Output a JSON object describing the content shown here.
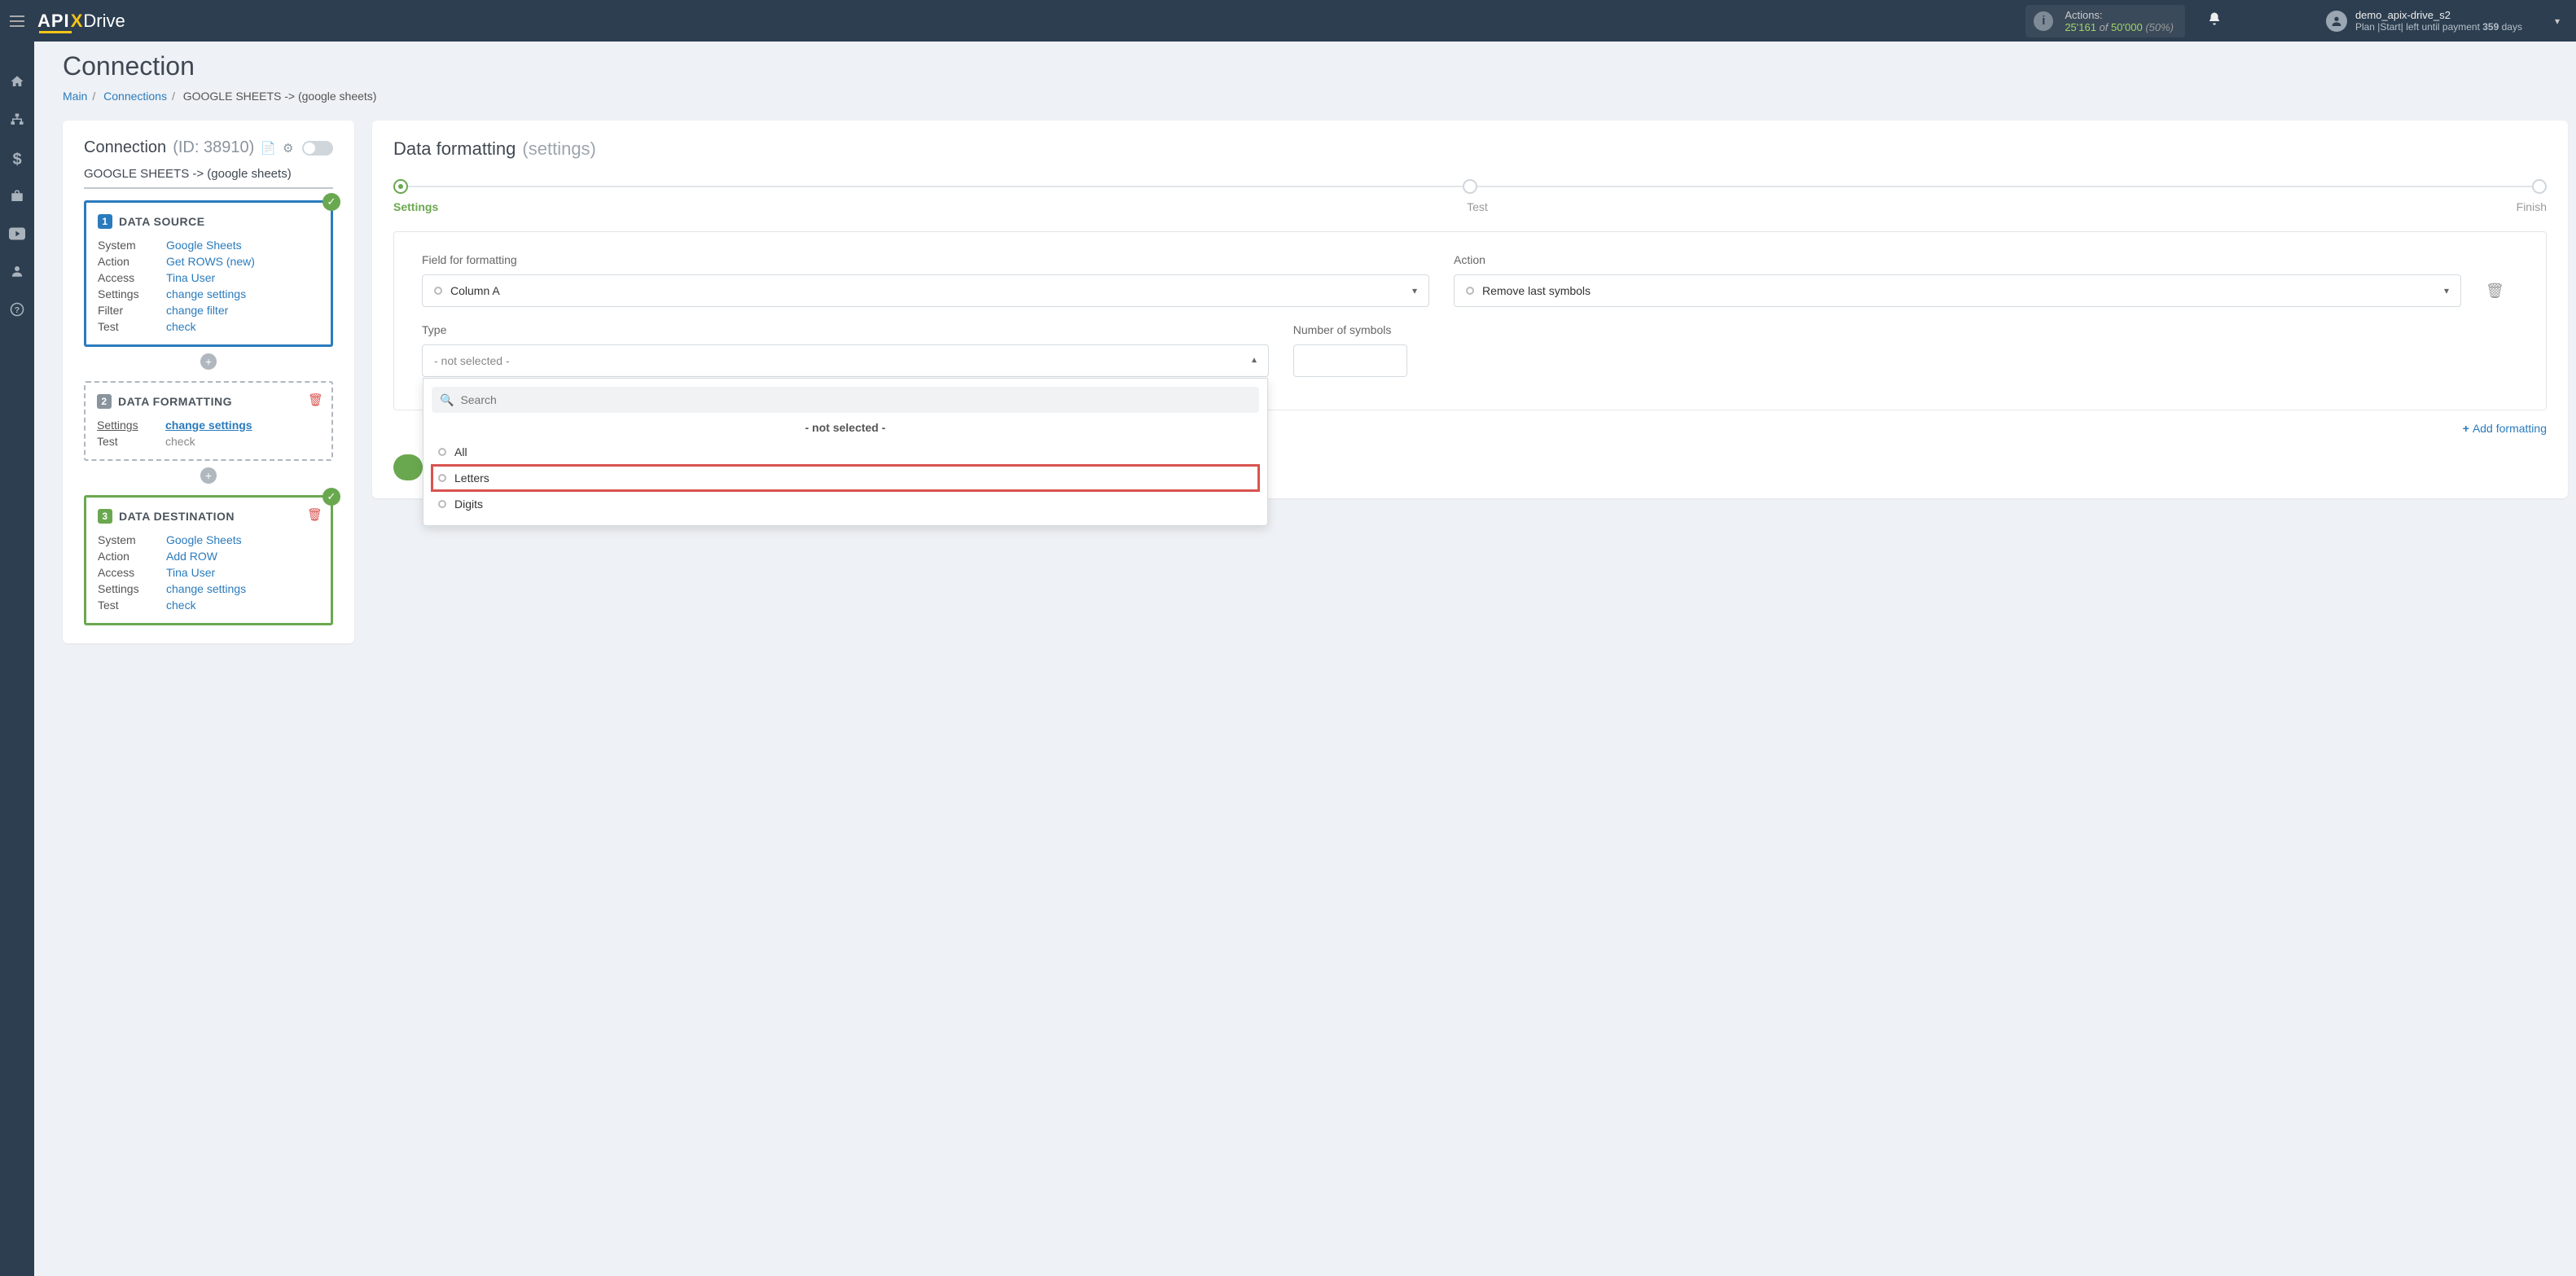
{
  "header": {
    "logo_parts": {
      "api": "API",
      "x": "X",
      "drive": "Drive"
    },
    "actions": {
      "label": "Actions:",
      "used": "25'161",
      "of": "of",
      "total": "50'000",
      "pct": "(50%)"
    },
    "user": {
      "name": "demo_apix-drive_s2",
      "plan_prefix": "Plan |Start| left until payment ",
      "days": "359",
      "plan_suffix": " days"
    }
  },
  "sidebar_icons": [
    "home",
    "sitemap",
    "dollar",
    "briefcase",
    "youtube",
    "user",
    "question"
  ],
  "page": {
    "title": "Connection",
    "breadcrumb": {
      "main": "Main",
      "connections": "Connections",
      "current": "GOOGLE SHEETS -> (google sheets)"
    }
  },
  "conn": {
    "title": "Connection",
    "id_label": "(ID: 38910)",
    "sub": "GOOGLE SHEETS -> (google sheets)"
  },
  "blocks": {
    "source": {
      "num": "1",
      "title": "DATA SOURCE",
      "rows": [
        {
          "k": "System",
          "v": "Google Sheets"
        },
        {
          "k": "Action",
          "v": "Get ROWS (new)"
        },
        {
          "k": "Access",
          "v": "Tina User"
        },
        {
          "k": "Settings",
          "v": "change settings"
        },
        {
          "k": "Filter",
          "v": "change filter"
        },
        {
          "k": "Test",
          "v": "check"
        }
      ]
    },
    "fmt": {
      "num": "2",
      "title": "DATA FORMATTING",
      "rows": [
        {
          "k": "Settings",
          "v": "change settings",
          "u": true
        },
        {
          "k": "Test",
          "v": "check",
          "muted": true
        }
      ]
    },
    "dest": {
      "num": "3",
      "title": "DATA DESTINATION",
      "rows": [
        {
          "k": "System",
          "v": "Google Sheets"
        },
        {
          "k": "Action",
          "v": "Add ROW"
        },
        {
          "k": "Access",
          "v": "Tina User"
        },
        {
          "k": "Settings",
          "v": "change settings"
        },
        {
          "k": "Test",
          "v": "check"
        }
      ]
    }
  },
  "right": {
    "title": "Data formatting",
    "subtitle": "(settings)",
    "steps": [
      "Settings",
      "Test",
      "Finish"
    ],
    "active_step": 0,
    "form": {
      "field_lbl": "Field for formatting",
      "field_val": "Column A",
      "action_lbl": "Action",
      "action_val": "Remove last symbols",
      "type_lbl": "Type",
      "type_val": "- not selected -",
      "num_lbl": "Number of symbols",
      "num_val": "",
      "search_ph": "Search",
      "dd_header": "- not selected -",
      "dd_opts": [
        "All",
        "Letters",
        "Digits"
      ],
      "dd_highlight": 1
    },
    "add_lbl": "Add formatting"
  }
}
